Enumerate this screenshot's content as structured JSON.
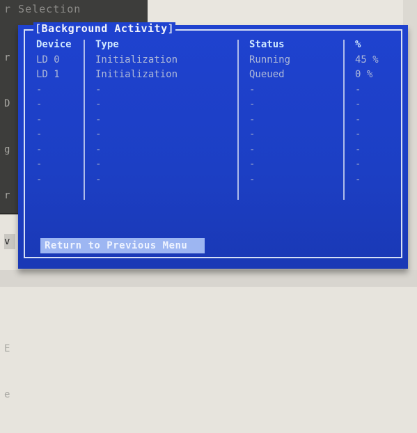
{
  "background_window": {
    "title": "r Selection",
    "left_letters": [
      "r",
      "D",
      "g",
      "r",
      "v",
      "",
      "",
      "E",
      "e"
    ]
  },
  "dialog": {
    "title": "Background Activity",
    "columns": {
      "device": "Device",
      "type": "Type",
      "status": "Status",
      "percent": "%"
    },
    "rows": [
      {
        "device": "LD 0",
        "type": "Initialization",
        "status": "Running",
        "percent": "45 %"
      },
      {
        "device": "LD 1",
        "type": "Initialization",
        "status": "Queued",
        "percent": "0 %"
      },
      {
        "device": "-",
        "type": "-",
        "status": "-",
        "percent": "-"
      },
      {
        "device": "-",
        "type": "-",
        "status": "-",
        "percent": "-"
      },
      {
        "device": "-",
        "type": "-",
        "status": "-",
        "percent": "-"
      },
      {
        "device": "-",
        "type": "-",
        "status": "-",
        "percent": "-"
      },
      {
        "device": "-",
        "type": "-",
        "status": "-",
        "percent": "-"
      },
      {
        "device": "-",
        "type": "-",
        "status": "-",
        "percent": "-"
      },
      {
        "device": "-",
        "type": "-",
        "status": "-",
        "percent": "-"
      }
    ],
    "return_label": "Return to Previous Menu"
  },
  "colors": {
    "dialog_blue": "#1f42cf",
    "header_cyan": "#cfe8ff",
    "button_highlight": "#9db6f2"
  }
}
